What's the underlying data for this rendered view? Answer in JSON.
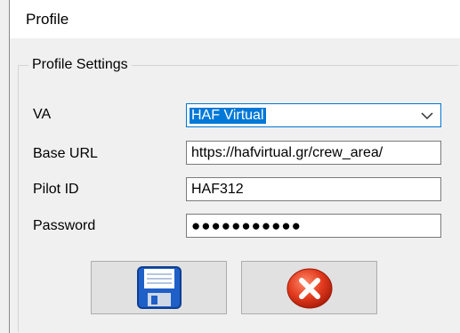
{
  "window": {
    "title": "Profile"
  },
  "group": {
    "legend": "Profile Settings"
  },
  "form": {
    "va": {
      "label": "VA",
      "value": "HAF Virtual"
    },
    "base_url": {
      "label": "Base URL",
      "value": "https://hafvirtual.gr/crew_area/"
    },
    "pilot_id": {
      "label": "Pilot ID",
      "value": "HAF312"
    },
    "password": {
      "label": "Password",
      "value": "●●●●●●●●●●●"
    }
  },
  "buttons": {
    "save": {
      "icon": "floppy-disk-icon"
    },
    "cancel": {
      "icon": "red-x-circle-icon"
    }
  },
  "colors": {
    "accent": "#0078d7",
    "window_bg": "#f0f0f0",
    "button_bg": "#e1e1e1",
    "cancel_red": "#e23b1e",
    "save_blue": "#1f5fc8"
  }
}
